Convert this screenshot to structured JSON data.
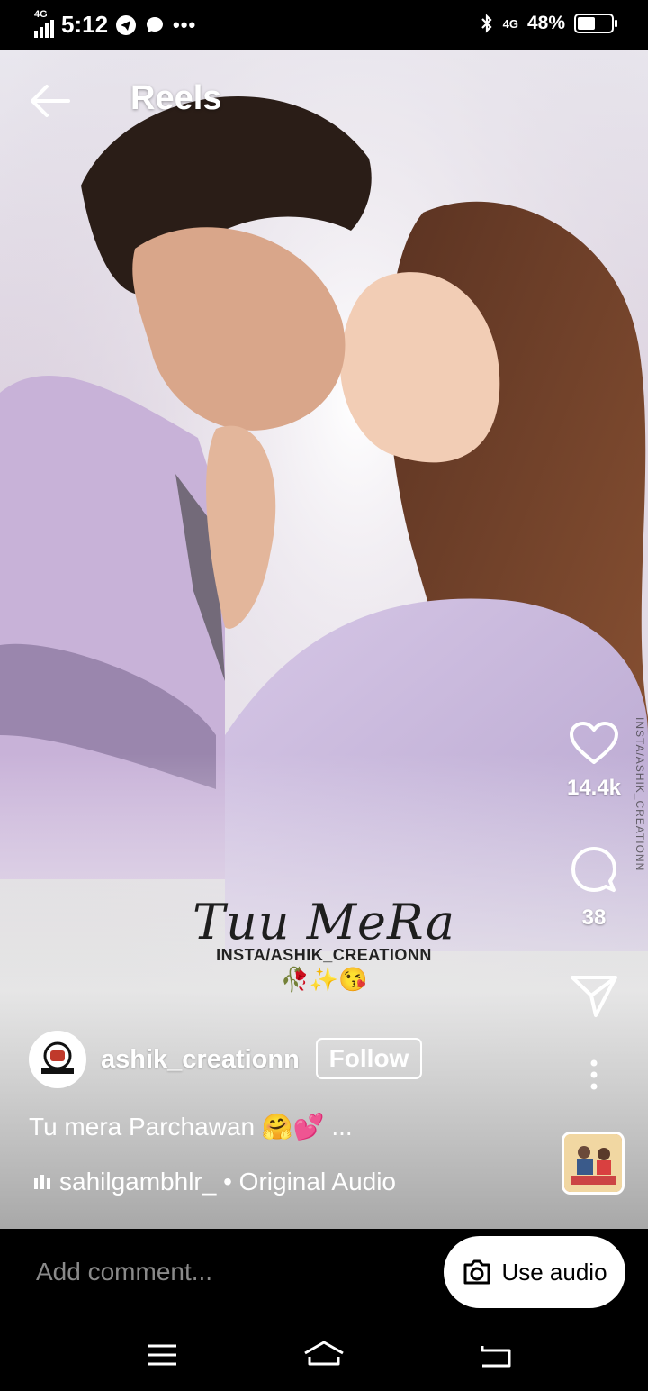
{
  "status_bar": {
    "network_left": "4G",
    "time": "5:12",
    "network_right": "4G",
    "battery_percent": "48%",
    "battery_level": 0.48,
    "notification_icons": [
      "telegram-icon",
      "chat-bubble-icon",
      "more-dots-icon"
    ]
  },
  "header": {
    "title": "Reels"
  },
  "video_overlay": {
    "title": "Tuu MeRa",
    "subtitle": "INSTA/ASHIK_CREATIONN",
    "emojis": "🥀✨😘",
    "watermark": "INSTA/ASHIK_CREATIONN"
  },
  "actions": {
    "likes": "14.4k",
    "comments": "38"
  },
  "author": {
    "username": "ashik_creationn",
    "follow_label": "Follow"
  },
  "caption": "Tu mera Parchawan 🤗💕 ...",
  "audio": {
    "label": "sahilgambhlr_ • Original Audio"
  },
  "comment_bar": {
    "placeholder": "Add comment...",
    "use_audio_label": "Use audio"
  },
  "colors": {
    "background": "#000000",
    "text": "#ffffff",
    "placeholder": "#8a8a8a"
  }
}
